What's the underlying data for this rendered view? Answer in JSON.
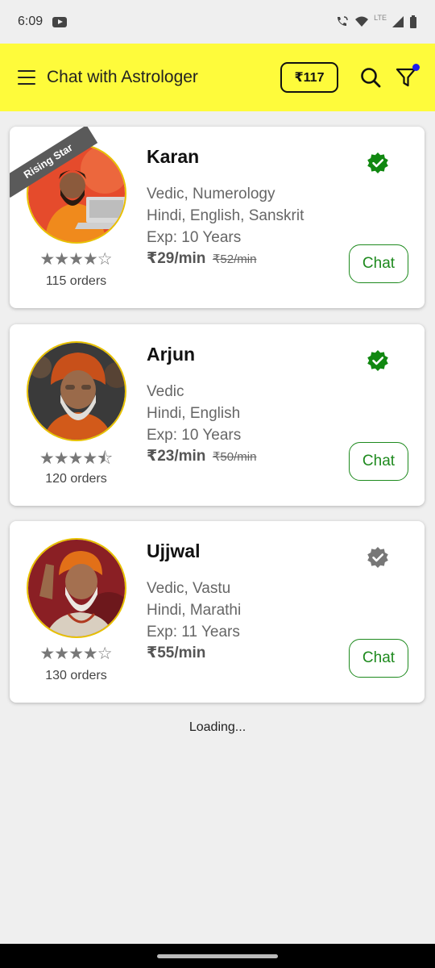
{
  "status_bar": {
    "time": "6:09",
    "network": "LTE"
  },
  "header": {
    "title": "Chat with Astrologer",
    "wallet_balance": "₹117"
  },
  "colors": {
    "app_bar": "#fefb3b",
    "verified_active": "#118811",
    "verified_inactive": "#777777",
    "chat_accent": "#1e8a1e"
  },
  "astrologers": [
    {
      "name": "Karan",
      "badge": "Rising Star",
      "verified": true,
      "skills": "Vedic, Numerology",
      "languages": "Hindi, English, Sanskrit",
      "experience": "Exp: 10 Years",
      "price": "₹29/min",
      "old_price": "₹52/min",
      "rating_stars": "★★★★☆",
      "orders": "115 orders",
      "chat_label": "Chat"
    },
    {
      "name": "Arjun",
      "verified": true,
      "skills": "Vedic",
      "languages": "Hindi, English",
      "experience": "Exp: 10 Years",
      "price": "₹23/min",
      "old_price": "₹50/min",
      "rating_stars": "★★★★⯪",
      "orders": "120 orders",
      "chat_label": "Chat"
    },
    {
      "name": "Ujjwal",
      "verified": false,
      "skills": "Vedic, Vastu",
      "languages": "Hindi, Marathi",
      "experience": "Exp: 11 Years",
      "price": "₹55/min",
      "rating_stars": "★★★★☆",
      "orders": "130 orders",
      "chat_label": "Chat"
    }
  ],
  "footer": {
    "loading_text": "Loading..."
  }
}
